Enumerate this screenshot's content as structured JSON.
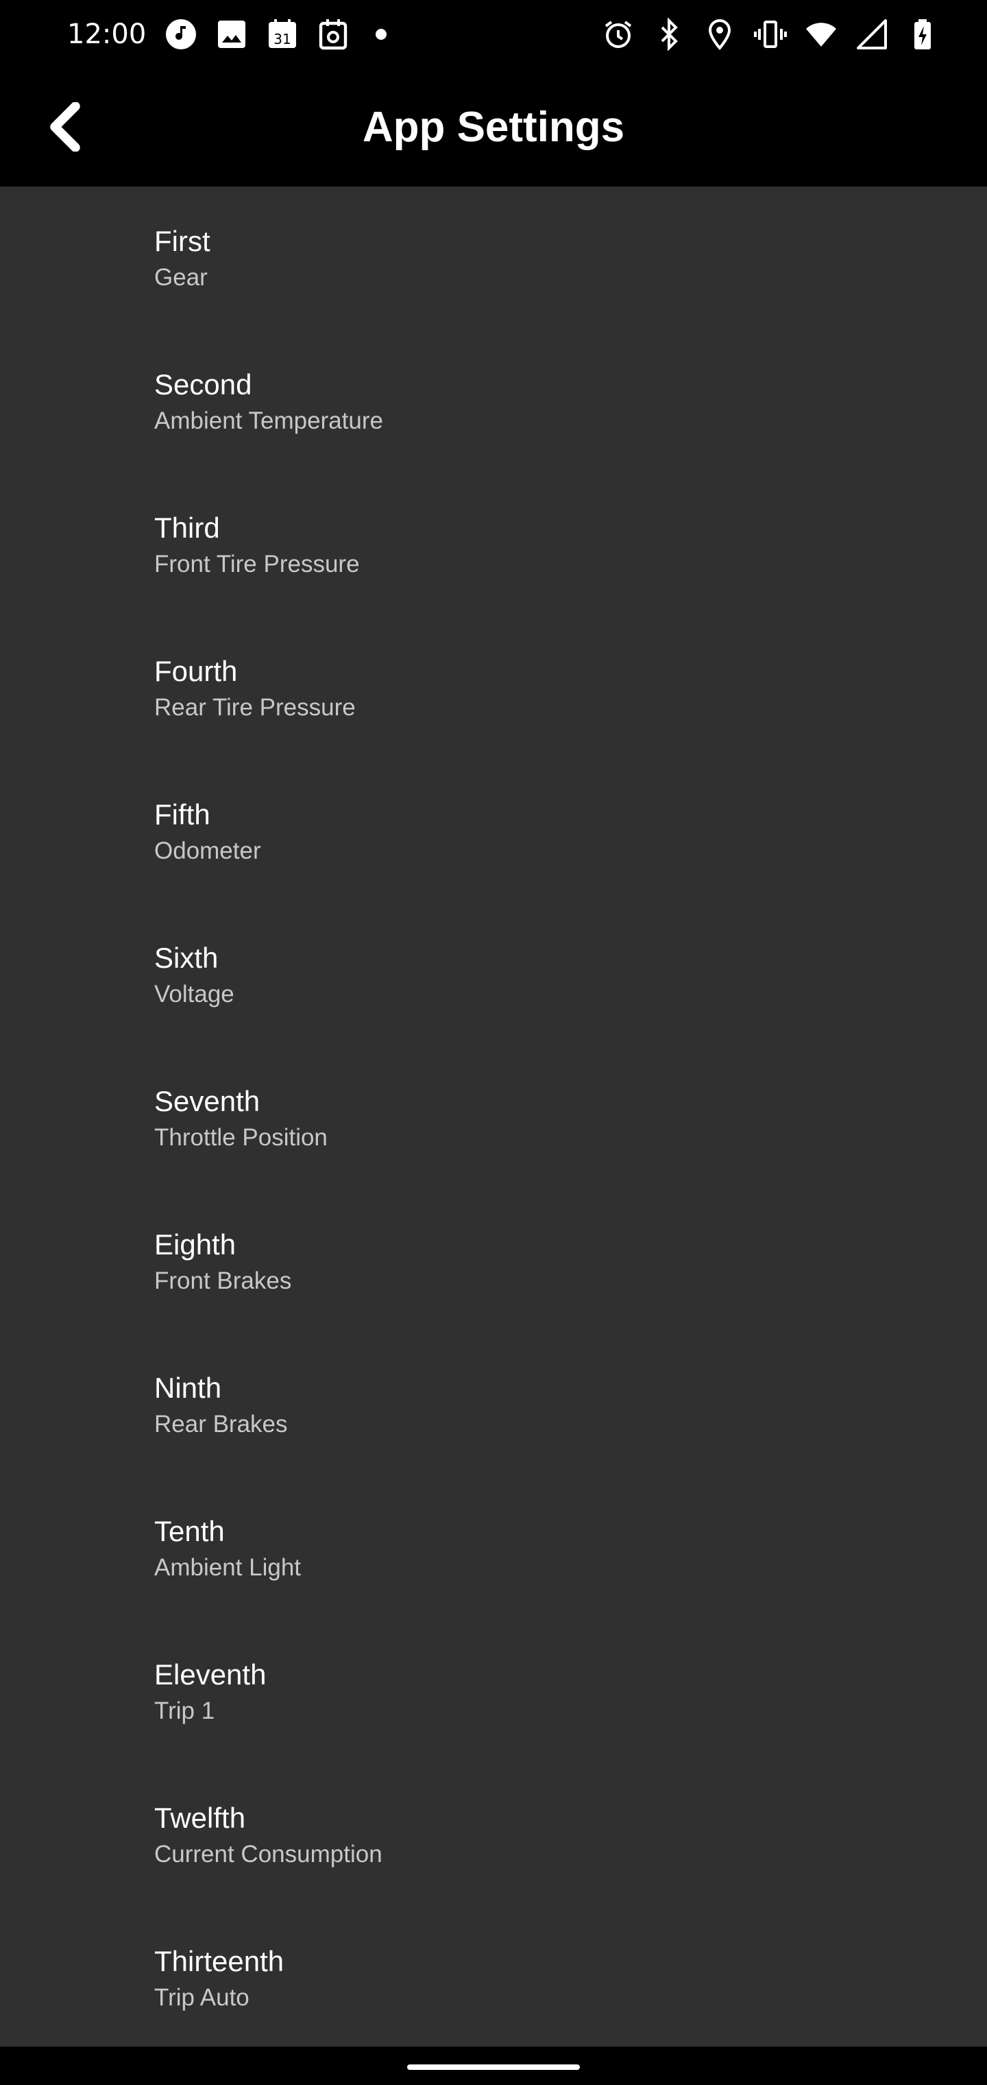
{
  "status_bar": {
    "time": "12:00",
    "left_icons": [
      "music-note-icon",
      "image-icon",
      "calendar-icon",
      "camera-calendar-icon",
      "notification-dot-icon"
    ],
    "right_icons": [
      "alarm-icon",
      "bluetooth-icon",
      "location-icon",
      "vibrate-icon",
      "wifi-icon",
      "signal-icon",
      "battery-charging-icon"
    ]
  },
  "app_bar": {
    "title": "App Settings",
    "back_icon": "chevron-left-icon"
  },
  "settings": [
    {
      "title": "First",
      "summary": "Gear"
    },
    {
      "title": "Second",
      "summary": "Ambient Temperature"
    },
    {
      "title": "Third",
      "summary": "Front Tire Pressure"
    },
    {
      "title": "Fourth",
      "summary": "Rear Tire Pressure"
    },
    {
      "title": "Fifth",
      "summary": "Odometer"
    },
    {
      "title": "Sixth",
      "summary": "Voltage"
    },
    {
      "title": "Seventh",
      "summary": "Throttle Position"
    },
    {
      "title": "Eighth",
      "summary": "Front Brakes"
    },
    {
      "title": "Ninth",
      "summary": "Rear Brakes"
    },
    {
      "title": "Tenth",
      "summary": "Ambient Light"
    },
    {
      "title": "Eleventh",
      "summary": "Trip 1"
    },
    {
      "title": "Twelfth",
      "summary": "Current Consumption"
    },
    {
      "title": "Thirteenth",
      "summary": "Trip Auto"
    }
  ],
  "colors": {
    "background": "#000000",
    "list_background": "#303030",
    "title_text": "#ffffff",
    "summary_text": "#c8c8c8"
  }
}
